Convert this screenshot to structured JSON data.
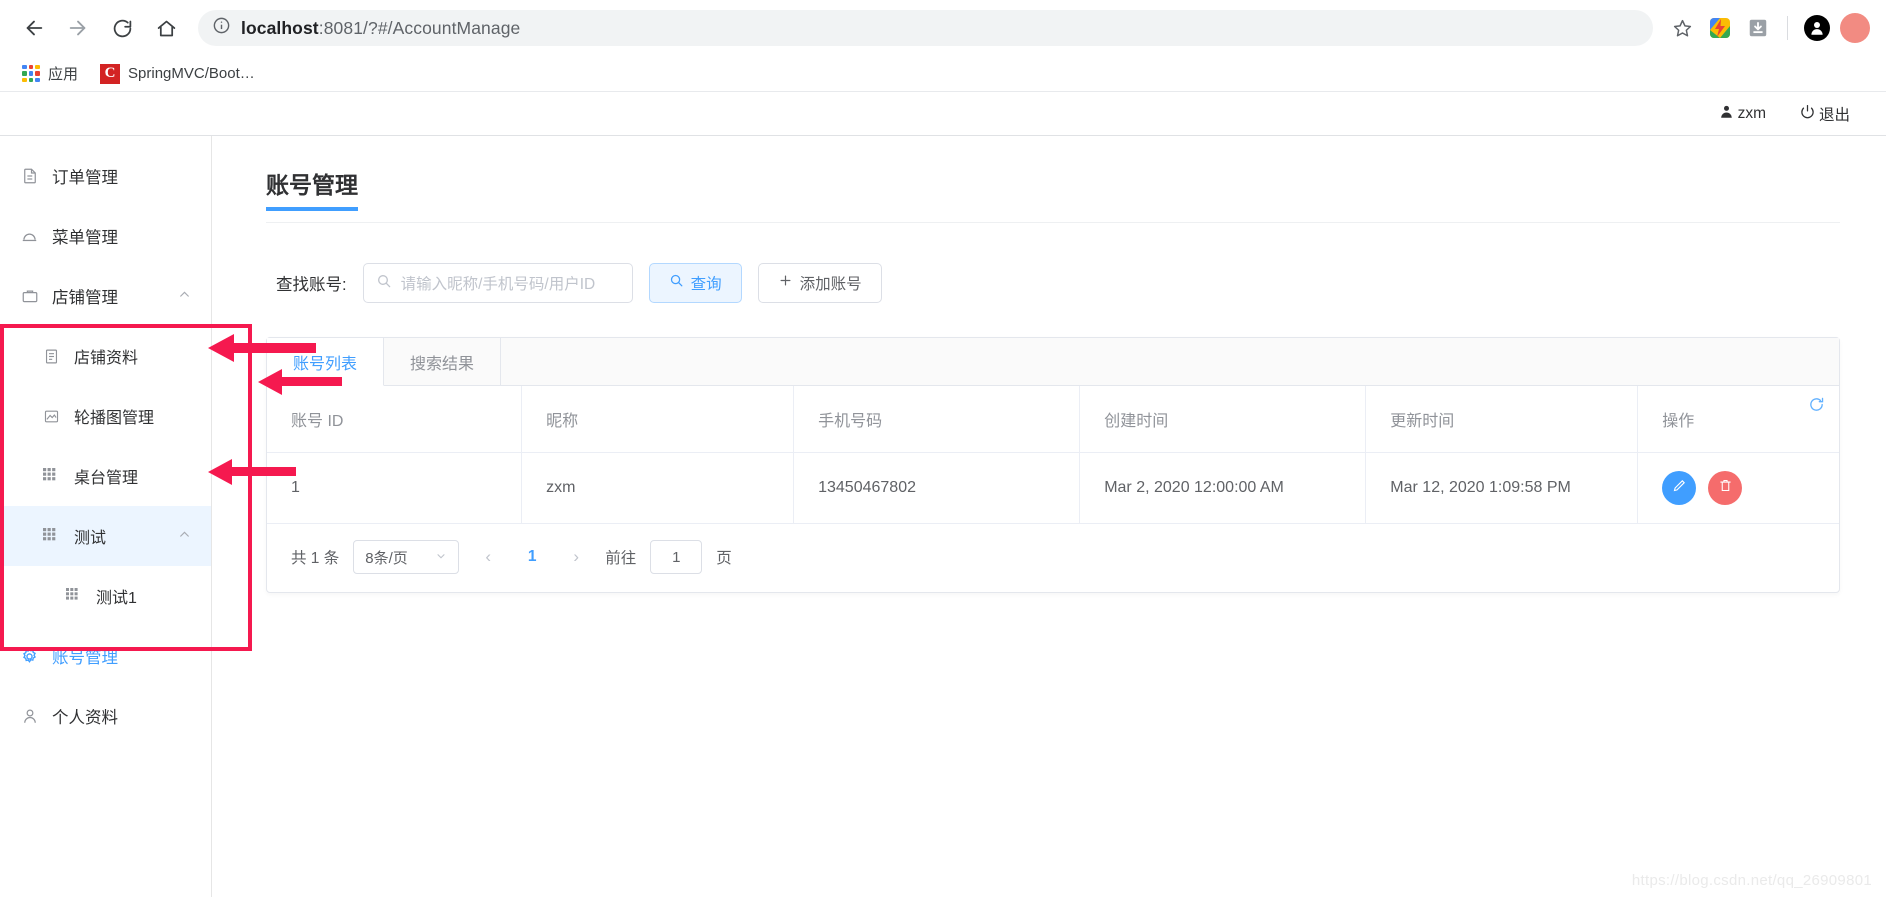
{
  "browser": {
    "url_host": "localhost",
    "url_rest": ":8081/?#/AccountManage",
    "nav": {
      "back": "back-arrow",
      "forward": "forward-arrow",
      "reload": "reload",
      "home": "home"
    },
    "bookmarks": [
      {
        "label": "应用",
        "icon": "apps-grid-icon"
      },
      {
        "label": "SpringMVC/Boot…",
        "icon": "spring-icon"
      }
    ],
    "toolbar_icons": [
      "star-icon",
      "colorful-extension-icon",
      "download-icon",
      "profile-avatar-icon",
      "red-extension-icon"
    ]
  },
  "app_header": {
    "user": "zxm",
    "user_icon": "user-icon",
    "logout": "退出",
    "logout_icon": "power-icon"
  },
  "sidebar": {
    "items": [
      {
        "label": "订单管理",
        "icon": "document-icon",
        "level": 0,
        "state": "normal",
        "arrow": ""
      },
      {
        "label": "菜单管理",
        "icon": "bell-dome-icon",
        "level": 0,
        "state": "normal",
        "arrow": ""
      },
      {
        "label": "店铺管理",
        "icon": "briefcase-icon",
        "level": 0,
        "state": "normal",
        "arrow": "chevron-up"
      },
      {
        "label": "店铺资料",
        "icon": "document-icon",
        "level": 1,
        "state": "normal",
        "arrow": ""
      },
      {
        "label": "轮播图管理",
        "icon": "picture-icon",
        "level": 1,
        "state": "normal",
        "arrow": ""
      },
      {
        "label": "桌台管理",
        "icon": "grid-icon",
        "level": 1,
        "state": "normal",
        "arrow": ""
      },
      {
        "label": "测试",
        "icon": "grid-icon",
        "level": 1,
        "state": "highlighted",
        "arrow": "chevron-up"
      },
      {
        "label": "测试1",
        "icon": "grid-icon",
        "level": 2,
        "state": "normal",
        "arrow": ""
      },
      {
        "label": "账号管理",
        "icon": "gear-icon",
        "level": 0,
        "state": "active",
        "arrow": ""
      },
      {
        "label": "个人资料",
        "icon": "person-icon",
        "level": 0,
        "state": "normal",
        "arrow": ""
      }
    ]
  },
  "main": {
    "page_title": "账号管理",
    "search": {
      "label": "查找账号:",
      "placeholder": "请输入昵称/手机号码/用户ID",
      "value": "",
      "query_button": "查询",
      "add_button": "添加账号"
    },
    "tabs": [
      {
        "label": "账号列表",
        "active": true
      },
      {
        "label": "搜索结果",
        "active": false
      }
    ],
    "table": {
      "columns": [
        "账号 ID",
        "昵称",
        "手机号码",
        "创建时间",
        "更新时间",
        "操作"
      ],
      "rows": [
        {
          "id": "1",
          "nickname": "zxm",
          "phone": "13450467802",
          "created": "Mar 2, 2020 12:00:00 AM",
          "updated": "Mar 12, 2020 1:09:58 PM",
          "edit_icon": "pencil-icon",
          "delete_icon": "trash-icon"
        }
      ],
      "refresh_icon": "refresh-icon"
    },
    "pagination": {
      "total": "共 1 条",
      "page_size": "8条/页",
      "prev": "‹",
      "pages": [
        "1"
      ],
      "next": "›",
      "jump_label": "前往",
      "jump_value": "1",
      "jump_unit": "页"
    }
  },
  "watermark": "https://blog.csdn.net/qq_26909801",
  "colors": {
    "accent": "#409eff",
    "highlight_bg": "#ecf5ff",
    "danger": "#f56c6c",
    "annotation_red": "#f5194f"
  }
}
